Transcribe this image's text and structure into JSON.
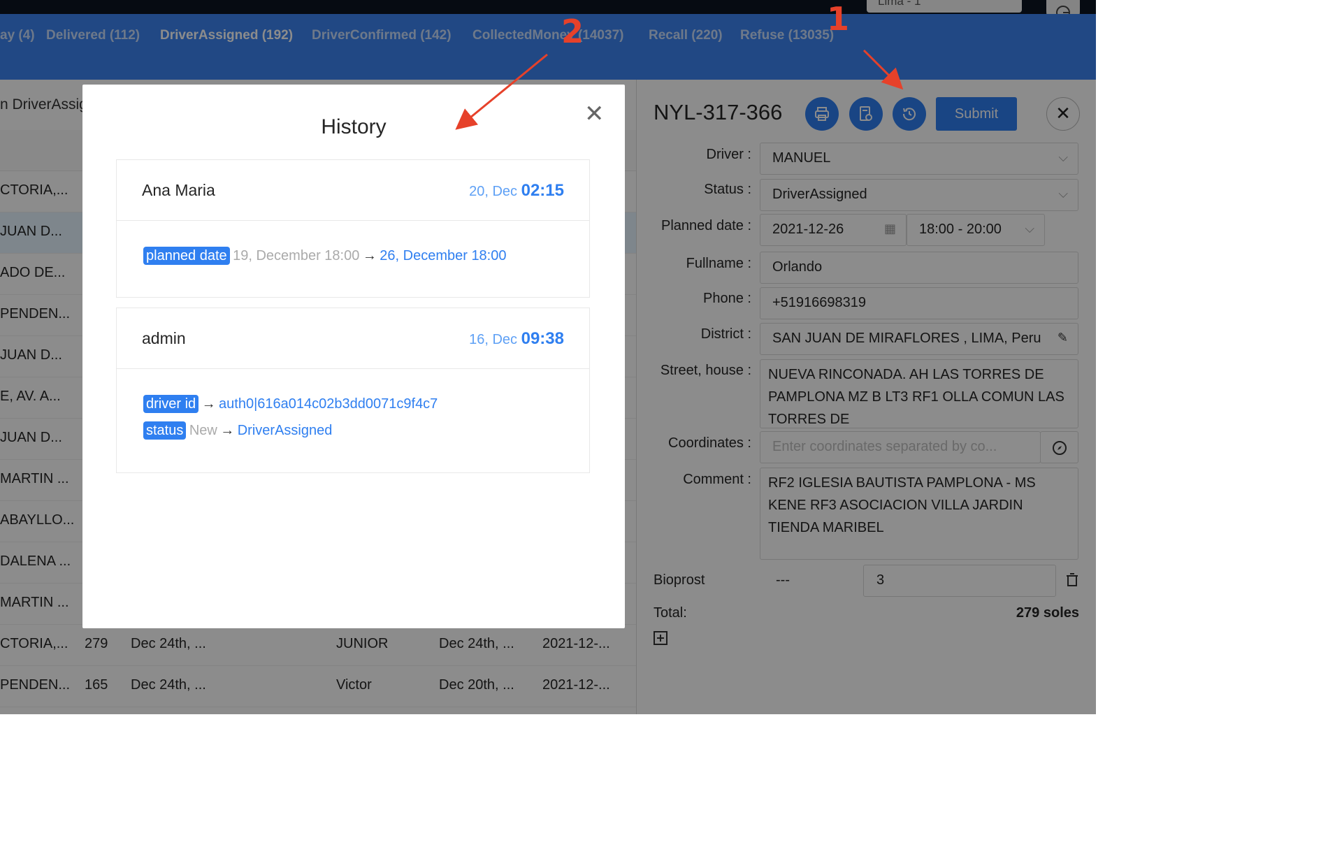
{
  "topbar": {
    "city_select": "Lima - 1"
  },
  "status_tabs": [
    {
      "label": "ay (4)",
      "active": false
    },
    {
      "label": "Delivered (112)",
      "active": false
    },
    {
      "label": "DriverAssigned (192)",
      "active": true
    },
    {
      "label": "DriverConfirmed (142)",
      "active": false
    },
    {
      "label": "CollectedMoney (14037)",
      "active": false
    },
    {
      "label": "Recall (220)",
      "active": false
    },
    {
      "label": "Refuse (13035)",
      "active": false
    }
  ],
  "list": {
    "title": "n DriverAssig",
    "rows": [
      {
        "district": "CTORIA,...",
        "selected": false
      },
      {
        "district": "JUAN D...",
        "selected": true
      },
      {
        "district": "ADO DE...",
        "selected": false
      },
      {
        "district": "PENDEN...",
        "selected": false
      },
      {
        "district": "JUAN D...",
        "selected": false
      },
      {
        "district": "E, AV. A...",
        "selected": false
      },
      {
        "district": "JUAN D...",
        "selected": false
      },
      {
        "district": "MARTIN ...",
        "selected": false
      },
      {
        "district": "ABAYLLO...",
        "selected": false
      },
      {
        "district": "DALENA ...",
        "selected": false
      },
      {
        "district": "MARTIN ...",
        "selected": false
      }
    ],
    "full_rows": [
      {
        "district": "CTORIA,...",
        "amount": "279",
        "created": "Dec 24th, ...",
        "driver": "JUNIOR",
        "updated": "Dec 24th, ...",
        "planned": "2021-12-..."
      },
      {
        "district": "PENDEN...",
        "amount": "165",
        "created": "Dec 24th, ...",
        "driver": "Victor",
        "updated": "Dec 20th, ...",
        "planned": "2021-12-..."
      }
    ]
  },
  "detail": {
    "order_id": "NYL-317-366",
    "submit_label": "Submit",
    "fields": {
      "driver_label": "Driver :",
      "driver_value": "MANUEL",
      "status_label": "Status :",
      "status_value": "DriverAssigned",
      "planned_label": "Planned date :",
      "planned_date": "2021-12-26",
      "planned_time": "18:00 - 20:00",
      "fullname_label": "Fullname :",
      "fullname_value": "Orlando",
      "phone_label": "Phone :",
      "phone_value": "+51916698319",
      "district_label": "District :",
      "district_value": "SAN JUAN DE MIRAFLORES , LIMA, Peru",
      "street_label": "Street, house :",
      "street_value": "NUEVA RINCONADA. AH LAS TORRES DE PAMPLONA MZ B LT3 RF1 OLLA COMUN LAS TORRES DE",
      "coords_label": "Coordinates :",
      "coords_placeholder": "Enter coordinates separated by co...",
      "comment_label": "Comment :",
      "comment_value": "RF2 IGLESIA BAUTISTA PAMPLONA - MS KENE RF3 ASOCIACION VILLA JARDIN TIENDA MARIBEL"
    },
    "product": {
      "name": "Bioprost",
      "price": "---",
      "quantity": "3"
    },
    "total_label": "Total:",
    "total_value": "279 soles"
  },
  "modal": {
    "title": "History",
    "entries": [
      {
        "user": "Ana Maria",
        "date": "20, Dec",
        "time": "02:15",
        "changes": [
          {
            "field": "planned date",
            "from": "19, December 18:00",
            "arrow": "→",
            "to": "26, December 18:00"
          }
        ]
      },
      {
        "user": "admin",
        "date": "16, Dec",
        "time": "09:38",
        "changes": [
          {
            "field": "driver id",
            "from": "",
            "arrow": "→",
            "to": "auth0|616a014c02b3dd0071c9f4c7"
          },
          {
            "field": "status",
            "from": "New",
            "arrow": "→",
            "to": "DriverAssigned"
          }
        ]
      }
    ]
  },
  "annotations": {
    "one": "1",
    "two": "2",
    "color": "#e6412a"
  }
}
